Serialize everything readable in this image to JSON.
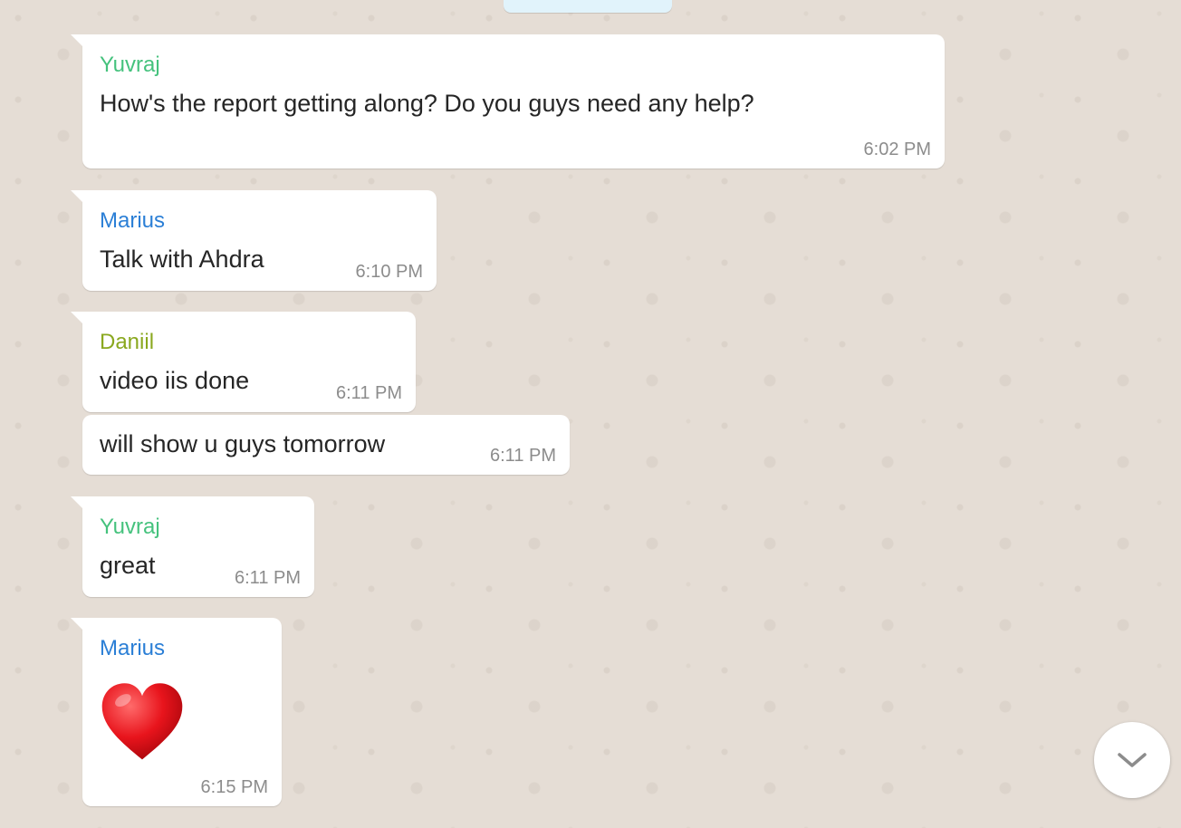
{
  "colors": {
    "yuvraj": "#45c27d",
    "marius": "#2b7fd6",
    "daniil": "#8aa81f"
  },
  "messages": [
    {
      "sender": "Yuvraj",
      "text": "How's the report getting along? Do you guys need any help?",
      "time": "6:02 PM"
    },
    {
      "sender": "Marius",
      "text": "Talk with Ahdra",
      "time": "6:10 PM"
    },
    {
      "sender": "Daniil",
      "text": "video iis done",
      "time": "6:11 PM"
    },
    {
      "sender": "",
      "text": "will show u guys tomorrow",
      "time": "6:11 PM"
    },
    {
      "sender": "Yuvraj",
      "text": "great",
      "time": "6:11 PM"
    },
    {
      "sender": "Marius",
      "emoji": "red-heart-icon",
      "time": "6:15 PM"
    }
  ],
  "scroll_button": {
    "icon": "chevron-down-icon"
  }
}
